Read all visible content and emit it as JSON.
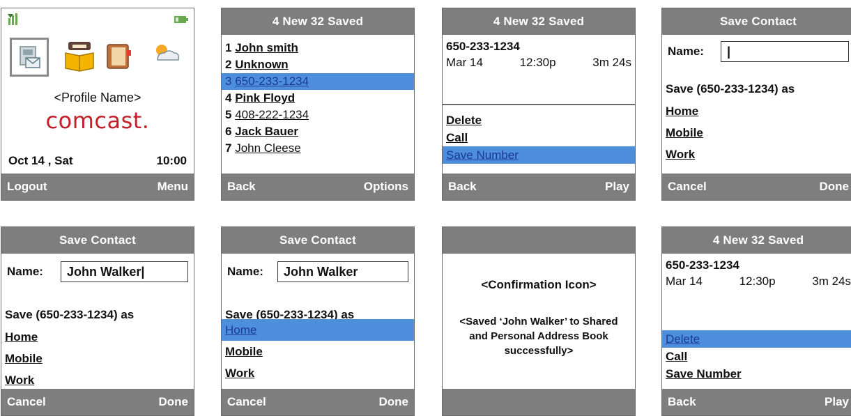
{
  "home": {
    "profile_name": "<Profile Name>",
    "logo": "comcast.",
    "date": "Oct 14 , Sat",
    "time": "10:00",
    "soft_left": "Logout",
    "soft_right": "Menu",
    "icons": [
      "signal-icon",
      "battery-icon",
      "mailbox-icon",
      "phone-book-icon",
      "notebook-icon",
      "weather-icon"
    ]
  },
  "voicemail_list": {
    "header": "4 New 32 Saved",
    "items": [
      {
        "num": "1",
        "name": "John smith",
        "bold": true
      },
      {
        "num": "2",
        "name": "Unknown",
        "bold": true
      },
      {
        "num": "3",
        "name": "650-233-1234",
        "bold": false
      },
      {
        "num": "4",
        "name": "Pink Floyd",
        "bold": true
      },
      {
        "num": "5",
        "name": "408-222-1234",
        "bold": false
      },
      {
        "num": "6",
        "name": "Jack Bauer",
        "bold": true
      },
      {
        "num": "7",
        "name": "John Cleese",
        "bold": false
      }
    ],
    "soft_left": "Back",
    "soft_right": "Options"
  },
  "message_detail_a": {
    "header": "4 New 32 Saved",
    "number": "650-233-1234",
    "date": "Mar 14",
    "time": "12:30p",
    "duration": "3m 24s",
    "options": [
      "Delete",
      "Call",
      "Save Number"
    ],
    "soft_left": "Back",
    "soft_right": "Play"
  },
  "save_contact_empty": {
    "header": "Save Contact",
    "name_label": "Name:",
    "name_value": "|",
    "save_as": "Save (650-233-1234) as",
    "choices": [
      "Home",
      "Mobile",
      "Work"
    ],
    "soft_left": "Cancel",
    "soft_right": "Done"
  },
  "save_contact_typing": {
    "header": "Save Contact",
    "name_label": "Name:",
    "name_value": "John Walker|",
    "save_as": "Save (650-233-1234) as",
    "choices": [
      "Home",
      "Mobile",
      "Work"
    ],
    "soft_left": "Cancel",
    "soft_right": "Done"
  },
  "save_contact_selected": {
    "header": "Save Contact",
    "name_label": "Name:",
    "name_value": "John Walker",
    "save_as": "Save (650-233-1234) as",
    "choices": [
      "Home",
      "Mobile",
      "Work"
    ],
    "soft_left": "Cancel",
    "soft_right": "Done"
  },
  "confirmation": {
    "title": "<Confirmation Icon>",
    "message": "<Saved ‘John Walker’ to Shared and Personal Address Book successfully>"
  },
  "message_detail_b": {
    "header": "4 New 32 Saved",
    "number": "650-233-1234",
    "date": "Mar 14",
    "time": "12:30p",
    "duration": "3m 24s",
    "options": [
      "Delete",
      "Call",
      "Save Number"
    ],
    "soft_left": "Back",
    "soft_right": "Play"
  },
  "colors": {
    "bar": "#7e7e7e",
    "highlight": "#4e8fdd",
    "highlight_text": "#1a3a8f",
    "logo": "#c3202a"
  }
}
